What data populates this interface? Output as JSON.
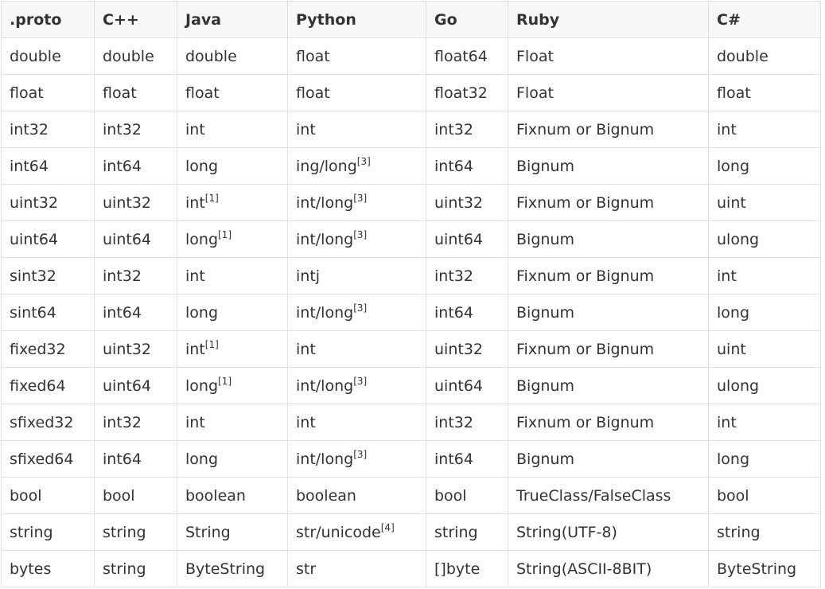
{
  "table": {
    "headers": [
      ".proto",
      "C++",
      "Java",
      "Python",
      "Go",
      "Ruby",
      "C#"
    ],
    "rows": [
      [
        {
          "t": "double"
        },
        {
          "t": "double"
        },
        {
          "t": "double"
        },
        {
          "t": "float"
        },
        {
          "t": "float64"
        },
        {
          "t": "Float"
        },
        {
          "t": "double"
        }
      ],
      [
        {
          "t": "float"
        },
        {
          "t": "float"
        },
        {
          "t": "float"
        },
        {
          "t": "float"
        },
        {
          "t": "float32"
        },
        {
          "t": "Float"
        },
        {
          "t": "float"
        }
      ],
      [
        {
          "t": "int32"
        },
        {
          "t": "int32"
        },
        {
          "t": "int"
        },
        {
          "t": "int"
        },
        {
          "t": "int32"
        },
        {
          "t": "Fixnum or Bignum"
        },
        {
          "t": "int"
        }
      ],
      [
        {
          "t": "int64"
        },
        {
          "t": "int64"
        },
        {
          "t": "long"
        },
        {
          "t": "ing/long",
          "sup": "[3]"
        },
        {
          "t": "int64"
        },
        {
          "t": "Bignum"
        },
        {
          "t": "long"
        }
      ],
      [
        {
          "t": "uint32"
        },
        {
          "t": "uint32"
        },
        {
          "t": "int",
          "sup": "[1]"
        },
        {
          "t": "int/long",
          "sup": "[3]"
        },
        {
          "t": "uint32"
        },
        {
          "t": "Fixnum or Bignum"
        },
        {
          "t": "uint"
        }
      ],
      [
        {
          "t": "uint64"
        },
        {
          "t": "uint64"
        },
        {
          "t": "long",
          "sup": "[1]"
        },
        {
          "t": "int/long",
          "sup": "[3]"
        },
        {
          "t": "uint64"
        },
        {
          "t": "Bignum"
        },
        {
          "t": "ulong"
        }
      ],
      [
        {
          "t": "sint32"
        },
        {
          "t": "int32"
        },
        {
          "t": "int"
        },
        {
          "t": "intj"
        },
        {
          "t": "int32"
        },
        {
          "t": "Fixnum or Bignum"
        },
        {
          "t": "int"
        }
      ],
      [
        {
          "t": "sint64"
        },
        {
          "t": "int64"
        },
        {
          "t": "long"
        },
        {
          "t": "int/long",
          "sup": "[3]"
        },
        {
          "t": "int64"
        },
        {
          "t": "Bignum"
        },
        {
          "t": "long"
        }
      ],
      [
        {
          "t": "fixed32"
        },
        {
          "t": "uint32"
        },
        {
          "t": "int",
          "sup": "[1]"
        },
        {
          "t": "int"
        },
        {
          "t": "uint32"
        },
        {
          "t": "Fixnum or Bignum"
        },
        {
          "t": "uint"
        }
      ],
      [
        {
          "t": "fixed64"
        },
        {
          "t": "uint64"
        },
        {
          "t": "long",
          "sup": "[1]"
        },
        {
          "t": "int/long",
          "sup": "[3]"
        },
        {
          "t": "uint64"
        },
        {
          "t": "Bignum"
        },
        {
          "t": "ulong"
        }
      ],
      [
        {
          "t": "sfixed32"
        },
        {
          "t": "int32"
        },
        {
          "t": "int"
        },
        {
          "t": "int"
        },
        {
          "t": "int32"
        },
        {
          "t": "Fixnum or Bignum"
        },
        {
          "t": "int"
        }
      ],
      [
        {
          "t": "sfixed64"
        },
        {
          "t": "int64"
        },
        {
          "t": "long"
        },
        {
          "t": "int/long",
          "sup": "[3]"
        },
        {
          "t": "int64"
        },
        {
          "t": "Bignum"
        },
        {
          "t": "long"
        }
      ],
      [
        {
          "t": "bool"
        },
        {
          "t": "bool"
        },
        {
          "t": "boolean"
        },
        {
          "t": "boolean"
        },
        {
          "t": "bool"
        },
        {
          "t": "TrueClass/FalseClass"
        },
        {
          "t": "bool"
        }
      ],
      [
        {
          "t": "string"
        },
        {
          "t": "string"
        },
        {
          "t": "String"
        },
        {
          "t": "str/unicode",
          "sup": "[4]"
        },
        {
          "t": "string"
        },
        {
          "t": "String(UTF-8)"
        },
        {
          "t": "string"
        }
      ],
      [
        {
          "t": "bytes"
        },
        {
          "t": "string"
        },
        {
          "t": "ByteString"
        },
        {
          "t": "str"
        },
        {
          "t": "[]byte"
        },
        {
          "t": "String(ASCII-8BIT)"
        },
        {
          "t": "ByteString"
        }
      ]
    ]
  },
  "colors": {
    "header_bg": "#f6f8fa",
    "border": "#dfe2e5",
    "text": "#333333"
  }
}
